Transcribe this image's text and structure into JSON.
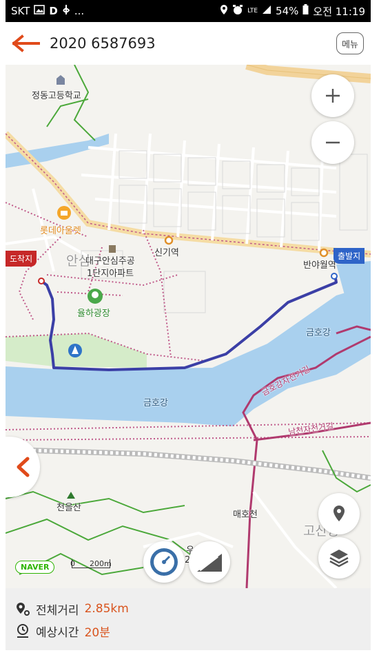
{
  "status_bar": {
    "carrier": "SKT",
    "left_icons": [
      "gallery-icon",
      "d-icon",
      "app-icon",
      "more-icon"
    ],
    "left_more": "...",
    "network": "LTE",
    "battery": "54%",
    "time": "오전 11:19"
  },
  "header": {
    "title": "2020 6587693",
    "menu_label": "메뉴"
  },
  "map": {
    "labels": {
      "school": "정동고등학교",
      "station1": "신기역",
      "station2": "반야월역",
      "lotte": "롯데아울렛",
      "apt": "대구안심주공",
      "apt2": "1단지아파트",
      "park": "율하광장",
      "river1": "금호강",
      "river2": "금호강",
      "bike1": "금호강자전거길",
      "bike2": "남천자전거길",
      "mountain": "천을산",
      "stream": "매호천",
      "district_anshim": "안심",
      "district_gosan": "고산동",
      "partial_num": "2",
      "partial_u": "우"
    },
    "start_flag": "출발지",
    "end_flag": "도착지",
    "scale": {
      "zero": "0",
      "dist": "200m"
    },
    "provider": "NAVER",
    "colors": {
      "route": "#3b3fa6",
      "bike_path": "#b03a6e",
      "water": "#a9d0ee",
      "start_flag": "#2f64c8",
      "end_flag": "#c62828"
    }
  },
  "info": {
    "distance_label": "전체거리",
    "distance_value": "2.85km",
    "time_label": "예상시간",
    "time_value": "20분"
  }
}
